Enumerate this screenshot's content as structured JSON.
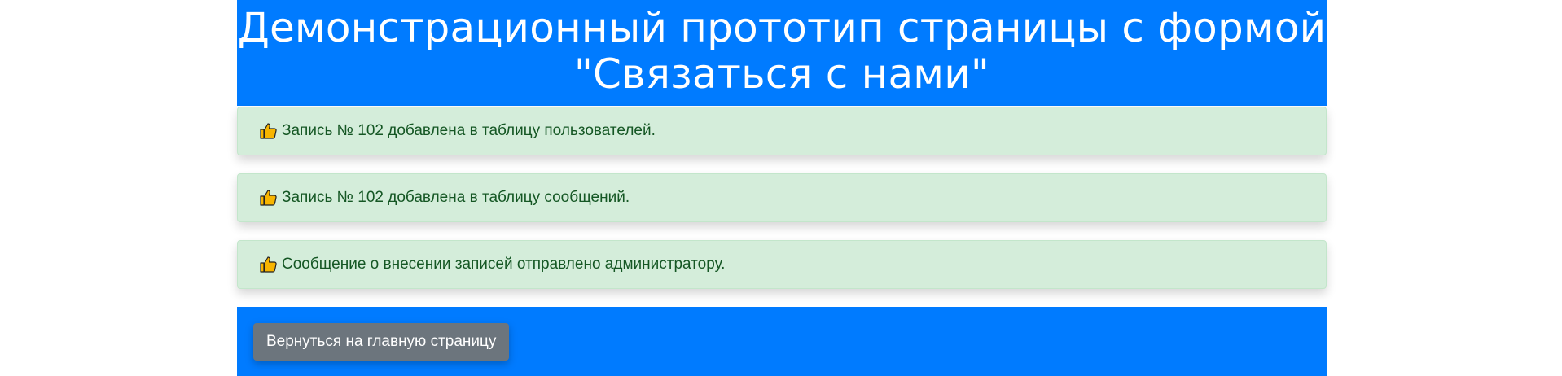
{
  "header": {
    "title_line1": "Демонстрационный прототип страницы с формой",
    "title_line2": "\"Связаться с нами\""
  },
  "alerts": [
    {
      "icon": "thumbs-up-icon",
      "text": "Запись № 102 добавлена в таблицу пользователей."
    },
    {
      "icon": "thumbs-up-icon",
      "text": "Запись № 102 добавлена в таблицу сообщений."
    },
    {
      "icon": "thumbs-up-icon",
      "text": "Сообщение о внесении записей отправлено администратору."
    }
  ],
  "footer": {
    "back_button_label": "Вернуться на главную страницу"
  },
  "colors": {
    "primary": "#007bff",
    "alert_bg": "#d4edda",
    "alert_text": "#155724",
    "button_bg": "#6c757d"
  }
}
